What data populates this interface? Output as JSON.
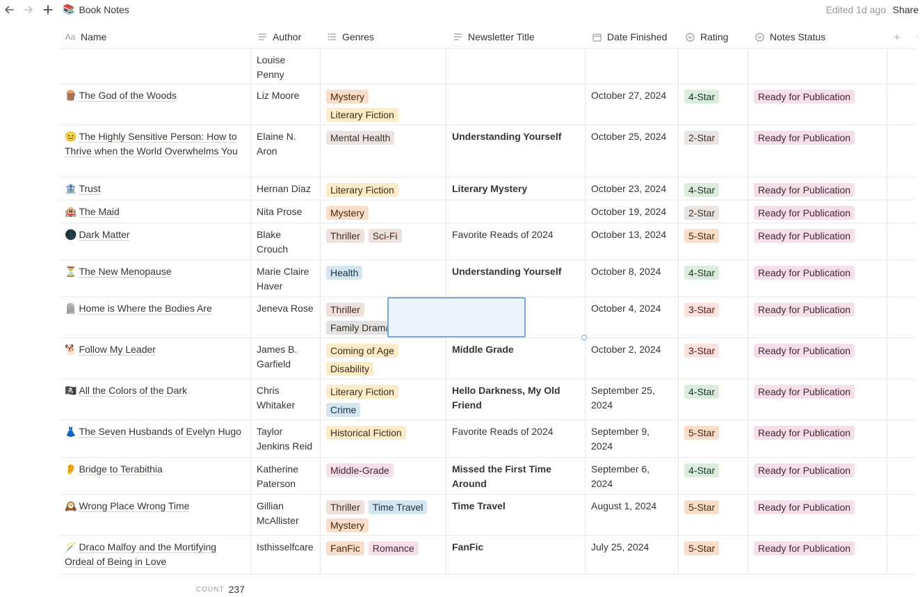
{
  "topbar": {
    "page_emoji": "📚",
    "page_title": "Book Notes",
    "edited": "Edited 1d ago",
    "share": "Share"
  },
  "columns": {
    "name": "Name",
    "author": "Author",
    "genres": "Genres",
    "newsletter": "Newsletter Title",
    "date": "Date Finished",
    "rating": "Rating",
    "status": "Notes Status",
    "name_icon": "Aa"
  },
  "rows": [
    {
      "emoji": "",
      "name": "",
      "author": "Louise Penny",
      "genres": [],
      "newsletter": "",
      "date": "",
      "rating": "",
      "status": ""
    },
    {
      "emoji": "🪵",
      "name": "The God of the Woods",
      "author": "Liz Moore",
      "genres": [
        "Mystery",
        "Literary Fiction"
      ],
      "newsletter": "",
      "date": "October 27, 2024",
      "rating": "4-Star",
      "status": "Ready for Publication"
    },
    {
      "emoji": "😐",
      "name": "The Highly Sensitive Person: How to Thrive when the World Overwhelms You",
      "author": "Elaine N. Aron",
      "genres": [
        "Mental Health"
      ],
      "newsletter": "Understanding Yourself",
      "date": "October 25, 2024",
      "rating": "2-Star",
      "status": "Ready for Publication"
    },
    {
      "emoji": "🏦",
      "name": "Trust",
      "author": "Hernan Diaz",
      "genres": [
        "Literary Fiction"
      ],
      "newsletter": "Literary Mystery",
      "date": "October 23, 2024",
      "rating": "4-Star",
      "status": "Ready for Publication"
    },
    {
      "emoji": "🏨",
      "name": "The Maid",
      "author": "Nita Prose",
      "genres": [
        "Mystery"
      ],
      "newsletter": "",
      "date": "October 19, 2024",
      "rating": "2-Star",
      "status": "Ready for Publication"
    },
    {
      "emoji": "🌑",
      "name": "Dark Matter",
      "author": "Blake Crouch",
      "genres": [
        "Thriller",
        "Sci-Fi"
      ],
      "newsletter": "Favorite Reads of 2024",
      "date": "October 13, 2024",
      "rating": "5-Star",
      "status": "Ready for Publication"
    },
    {
      "emoji": "⏳",
      "name": "The New Menopause",
      "author": "Marie Claire Haver",
      "genres": [
        "Health"
      ],
      "newsletter": "Understanding Yourself",
      "date": "October 8, 2024",
      "rating": "4-Star",
      "status": "Ready for Publication"
    },
    {
      "emoji": "🪦",
      "name": "Home is Where the Bodies Are",
      "author": "Jeneva Rose",
      "genres": [
        "Thriller",
        "Family Drama"
      ],
      "newsletter": "",
      "date": "October 4, 2024",
      "rating": "3-Star",
      "status": "Ready for Publication"
    },
    {
      "emoji": "🐕",
      "name": "Follow My Leader",
      "author": "James B. Garfield",
      "genres": [
        "Coming of Age",
        "Disability"
      ],
      "newsletter": "Middle Grade",
      "date": "October 2, 2024",
      "rating": "3-Star",
      "status": "Ready for Publication"
    },
    {
      "emoji": "🏴‍☠️",
      "name": "All the Colors of the Dark",
      "author": "Chris Whitaker",
      "genres": [
        "Literary Fiction",
        "Crime"
      ],
      "newsletter": "Hello Darkness, My Old Friend",
      "date": "September 25, 2024",
      "rating": "4-Star",
      "status": "Ready for Publication"
    },
    {
      "emoji": "👗",
      "name": "The Seven Husbands of Evelyn Hugo",
      "author": "Taylor Jenkins Reid",
      "genres": [
        "Historical Fiction"
      ],
      "newsletter": "Favorite Reads of 2024",
      "date": "September 9, 2024",
      "rating": "5-Star",
      "status": "Ready for Publication"
    },
    {
      "emoji": "👂",
      "name": "Bridge to Terabithia",
      "author": "Katherine Paterson",
      "genres": [
        "Middle-Grade"
      ],
      "newsletter": "Missed the First Time Around",
      "date": "September 6, 2024",
      "rating": "4-Star",
      "status": "Ready for Publication"
    },
    {
      "emoji": "🕰️",
      "name": "Wrong Place Wrong Time",
      "author": "Gillian McAllister",
      "genres": [
        "Thriller",
        "Time Travel",
        "Mystery"
      ],
      "newsletter": "Time Travel",
      "date": "August 1, 2024",
      "rating": "5-Star",
      "status": "Ready for Publication"
    },
    {
      "emoji": "🪄",
      "name": "Draco Malfoy and the Mortifying Ordeal of Being in Love",
      "author": "Isthisselfcare",
      "genres": [
        "FanFic",
        "Romance"
      ],
      "newsletter": "FanFic",
      "date": "July 25, 2024",
      "rating": "5-Star",
      "status": "Ready for Publication"
    }
  ],
  "footer": {
    "count_label": "COUNT",
    "count_value": "237"
  }
}
